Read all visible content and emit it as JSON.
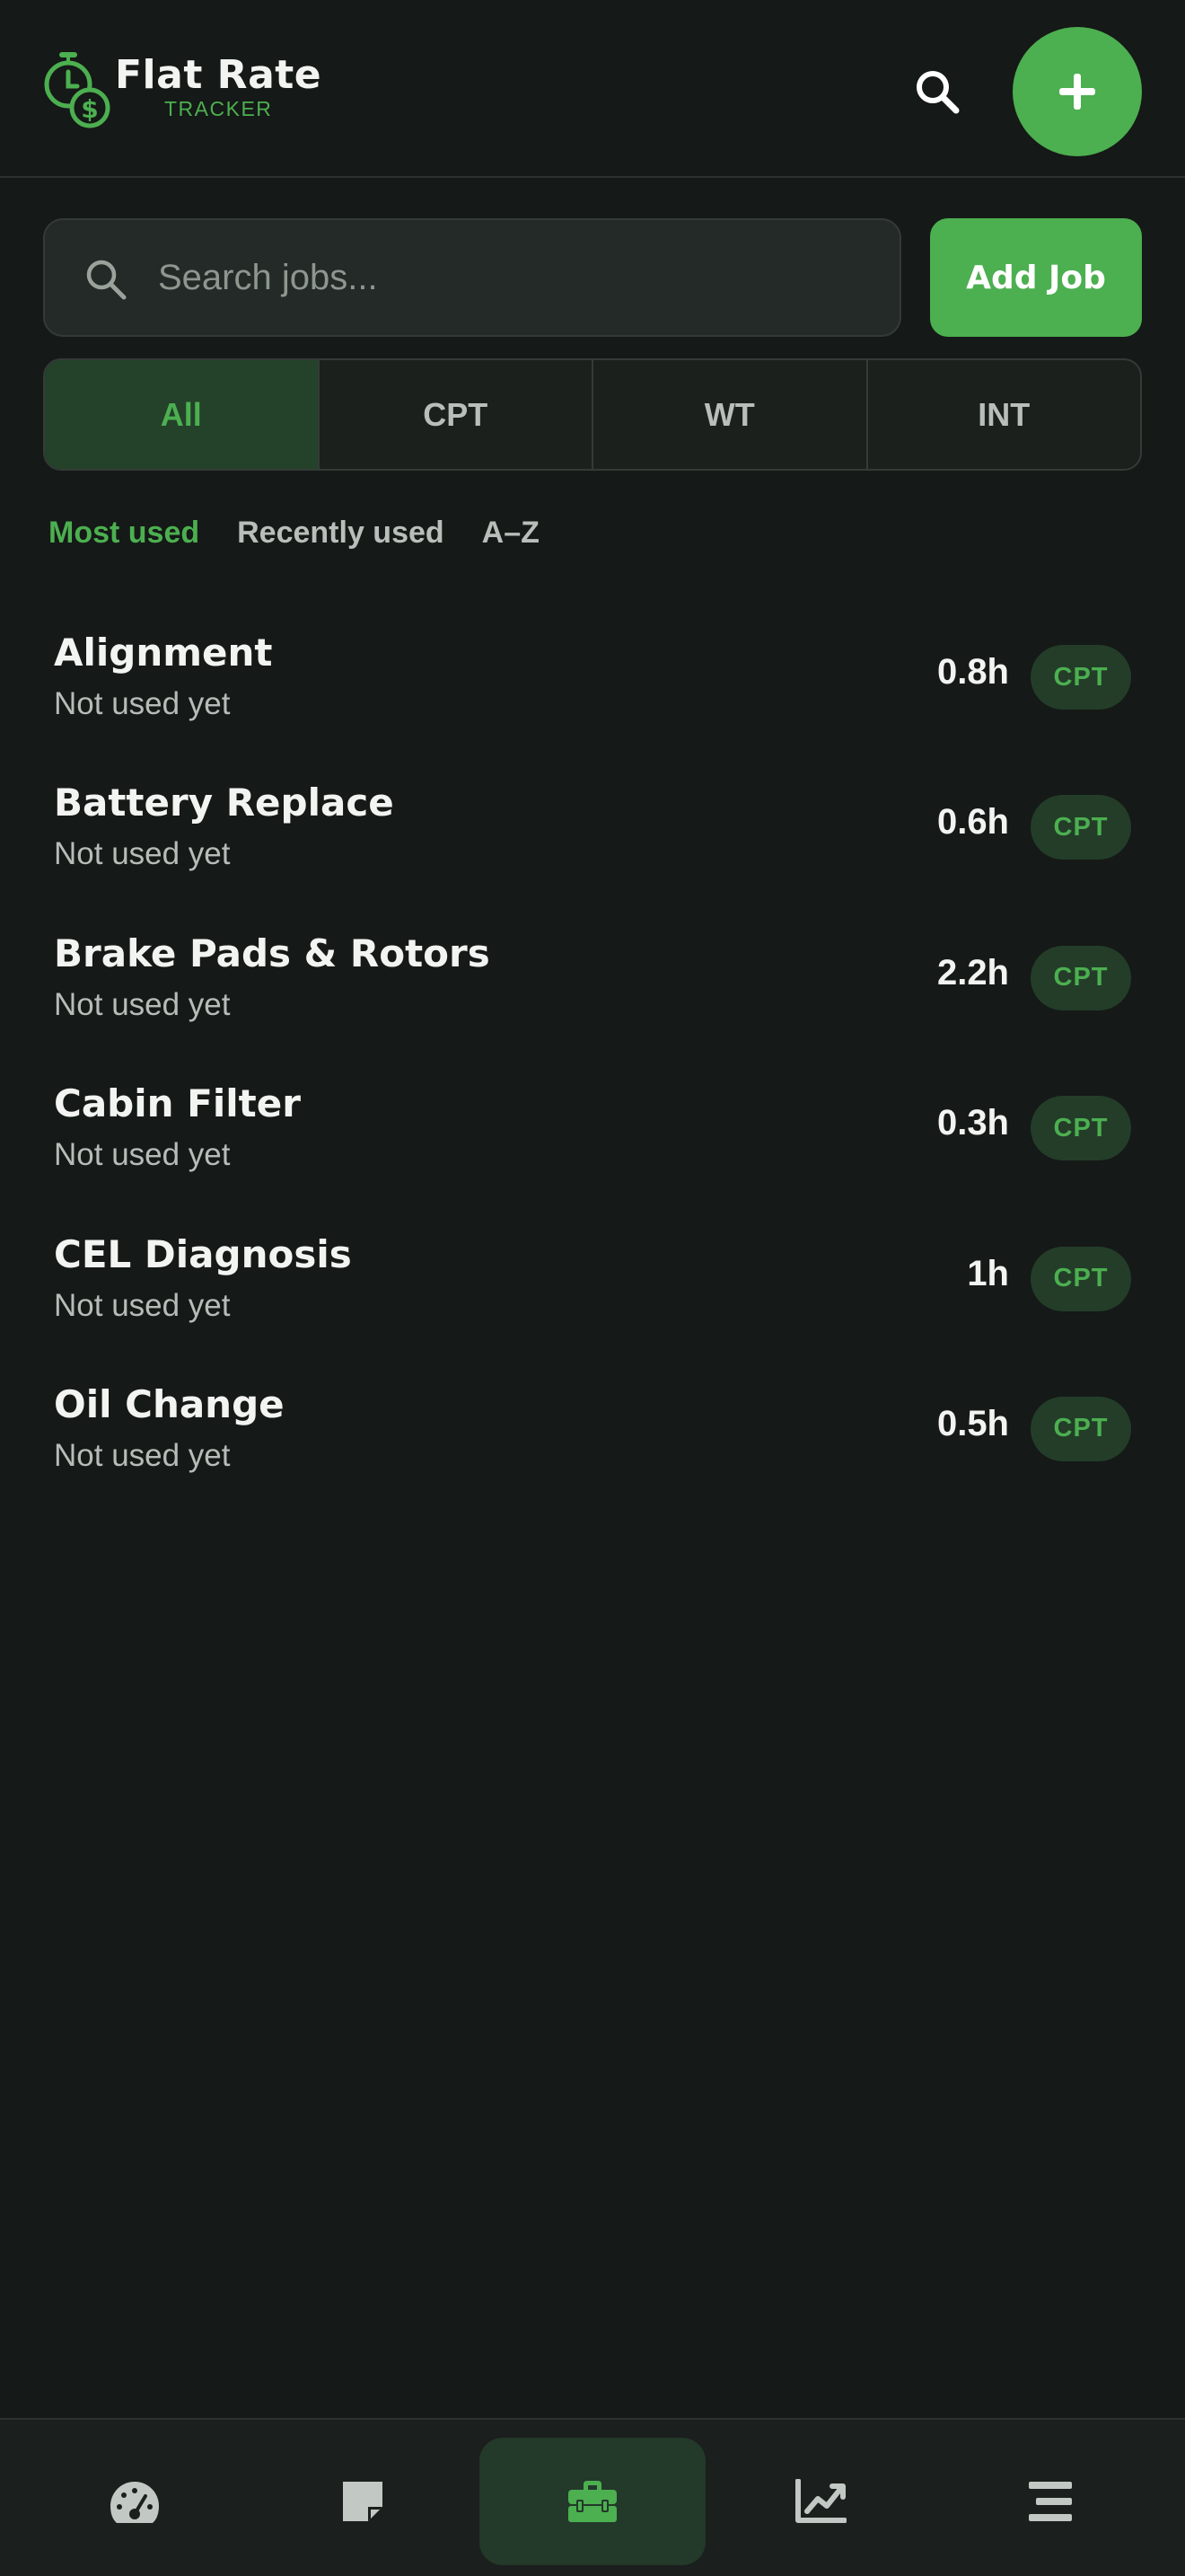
{
  "header": {
    "brand_title": "Flat Rate",
    "brand_subtitle": "TRACKER",
    "logo_icon": "stopwatch-dollar-icon",
    "search_icon": "search-icon",
    "add_icon": "plus-icon"
  },
  "search": {
    "placeholder": "Search jobs...",
    "value": "",
    "icon": "search-icon"
  },
  "add_job_label": "Add Job",
  "filters": {
    "selected": "All",
    "items": [
      {
        "label": "All"
      },
      {
        "label": "CPT"
      },
      {
        "label": "WT"
      },
      {
        "label": "INT"
      }
    ]
  },
  "sort": {
    "selected": "Most used",
    "items": [
      {
        "label": "Most used"
      },
      {
        "label": "Recently used"
      },
      {
        "label": "A–Z"
      }
    ]
  },
  "jobs": [
    {
      "name": "Alignment",
      "status": "Not used yet",
      "hours": "0.8h",
      "type": "CPT"
    },
    {
      "name": "Battery Replace",
      "status": "Not used yet",
      "hours": "0.6h",
      "type": "CPT"
    },
    {
      "name": "Brake Pads & Rotors",
      "status": "Not used yet",
      "hours": "2.2h",
      "type": "CPT"
    },
    {
      "name": "Cabin Filter",
      "status": "Not used yet",
      "hours": "0.3h",
      "type": "CPT"
    },
    {
      "name": "CEL Diagnosis",
      "status": "Not used yet",
      "hours": "1h",
      "type": "CPT"
    },
    {
      "name": "Oil Change",
      "status": "Not used yet",
      "hours": "0.5h",
      "type": "CPT"
    }
  ],
  "bottom_nav": {
    "active": "jobs",
    "items": [
      {
        "id": "dashboard",
        "icon": "speedometer-icon"
      },
      {
        "id": "notes",
        "icon": "sticky-note-icon"
      },
      {
        "id": "jobs",
        "icon": "toolbox-icon"
      },
      {
        "id": "reports",
        "icon": "trending-chart-icon"
      },
      {
        "id": "menu",
        "icon": "menu-icon"
      }
    ]
  },
  "colors": {
    "background": "#151917",
    "accent": "#4caf50",
    "surface": "#242a27",
    "badge_bg": "#233d29",
    "text_primary": "#f2f4f2",
    "text_secondary": "#b6bcb8"
  }
}
